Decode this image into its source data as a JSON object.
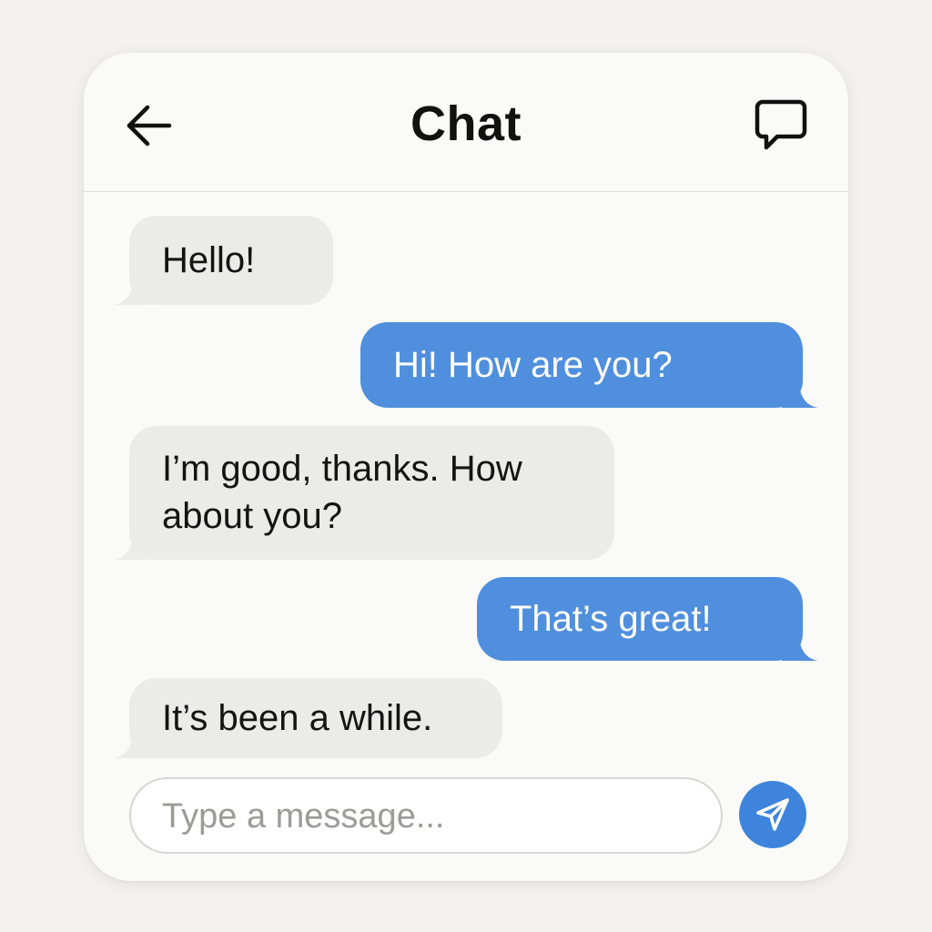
{
  "header": {
    "title": "Chat",
    "back_icon": "arrow-left-icon",
    "chat_icon": "chat-bubble-icon"
  },
  "messages": [
    {
      "direction": "incoming",
      "text": "Hello!"
    },
    {
      "direction": "outgoing",
      "text": "Hi! How are you?"
    },
    {
      "direction": "incoming",
      "text": "I’m good, thanks. How about you?"
    },
    {
      "direction": "outgoing",
      "text": "That’s great!"
    },
    {
      "direction": "incoming",
      "text": "It’s been a while."
    }
  ],
  "composer": {
    "value": "",
    "placeholder": "Type a message...",
    "send_icon": "paper-plane-icon"
  },
  "colors": {
    "incoming_bubble": "#ebebe8",
    "outgoing_bubble": "#4f8fdd",
    "send_button": "#3f84dc",
    "background": "#f3f2ef",
    "card": "#fafaf8"
  }
}
